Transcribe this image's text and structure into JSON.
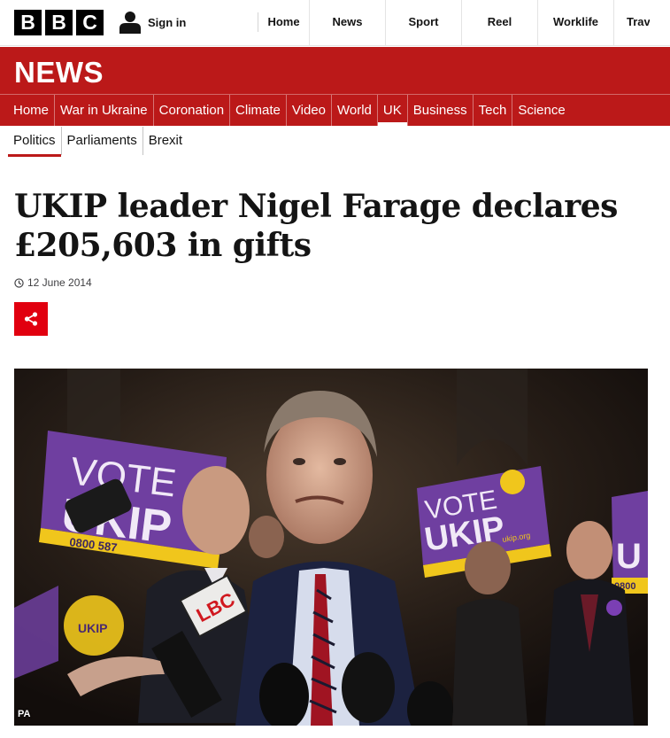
{
  "header": {
    "logo_letters": [
      "B",
      "B",
      "C"
    ],
    "signin_label": "Sign in",
    "nav": [
      "Home",
      "News",
      "Sport",
      "Reel",
      "Worklife",
      "Trav"
    ]
  },
  "news": {
    "title": "NEWS",
    "subnav": [
      {
        "label": "Home",
        "active": false
      },
      {
        "label": "War in Ukraine",
        "active": false
      },
      {
        "label": "Coronation",
        "active": false
      },
      {
        "label": "Climate",
        "active": false
      },
      {
        "label": "Video",
        "active": false
      },
      {
        "label": "World",
        "active": false
      },
      {
        "label": "UK",
        "active": true
      },
      {
        "label": "Business",
        "active": false
      },
      {
        "label": "Tech",
        "active": false
      },
      {
        "label": "Science",
        "active": false
      }
    ],
    "brand_color": "#bb1919"
  },
  "section_nav": [
    {
      "label": "Politics",
      "active": true
    },
    {
      "label": "Parliaments",
      "active": false
    },
    {
      "label": "Brexit",
      "active": false
    }
  ],
  "article": {
    "headline": "UKIP leader Nigel Farage declares £205,603 in gifts",
    "date": "12 June 2014",
    "share_icon": "share-icon",
    "share_color": "#e1000f",
    "image": {
      "credit": "PA",
      "signs": [
        "VOTE",
        "UKIP",
        "0800 587",
        "ukip.org",
        "0800"
      ],
      "mic_label": "LBC"
    }
  }
}
